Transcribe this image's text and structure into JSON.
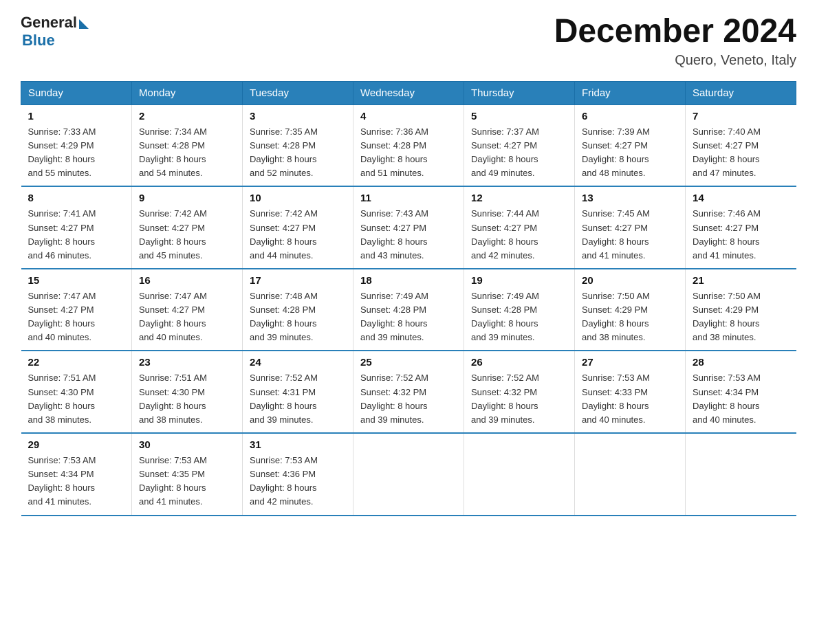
{
  "header": {
    "logo_general": "General",
    "logo_blue": "Blue",
    "title": "December 2024",
    "location": "Quero, Veneto, Italy"
  },
  "weekdays": [
    "Sunday",
    "Monday",
    "Tuesday",
    "Wednesday",
    "Thursday",
    "Friday",
    "Saturday"
  ],
  "weeks": [
    [
      {
        "day": "1",
        "sunrise": "7:33 AM",
        "sunset": "4:29 PM",
        "daylight": "8 hours and 55 minutes."
      },
      {
        "day": "2",
        "sunrise": "7:34 AM",
        "sunset": "4:28 PM",
        "daylight": "8 hours and 54 minutes."
      },
      {
        "day": "3",
        "sunrise": "7:35 AM",
        "sunset": "4:28 PM",
        "daylight": "8 hours and 52 minutes."
      },
      {
        "day": "4",
        "sunrise": "7:36 AM",
        "sunset": "4:28 PM",
        "daylight": "8 hours and 51 minutes."
      },
      {
        "day": "5",
        "sunrise": "7:37 AM",
        "sunset": "4:27 PM",
        "daylight": "8 hours and 49 minutes."
      },
      {
        "day": "6",
        "sunrise": "7:39 AM",
        "sunset": "4:27 PM",
        "daylight": "8 hours and 48 minutes."
      },
      {
        "day": "7",
        "sunrise": "7:40 AM",
        "sunset": "4:27 PM",
        "daylight": "8 hours and 47 minutes."
      }
    ],
    [
      {
        "day": "8",
        "sunrise": "7:41 AM",
        "sunset": "4:27 PM",
        "daylight": "8 hours and 46 minutes."
      },
      {
        "day": "9",
        "sunrise": "7:42 AM",
        "sunset": "4:27 PM",
        "daylight": "8 hours and 45 minutes."
      },
      {
        "day": "10",
        "sunrise": "7:42 AM",
        "sunset": "4:27 PM",
        "daylight": "8 hours and 44 minutes."
      },
      {
        "day": "11",
        "sunrise": "7:43 AM",
        "sunset": "4:27 PM",
        "daylight": "8 hours and 43 minutes."
      },
      {
        "day": "12",
        "sunrise": "7:44 AM",
        "sunset": "4:27 PM",
        "daylight": "8 hours and 42 minutes."
      },
      {
        "day": "13",
        "sunrise": "7:45 AM",
        "sunset": "4:27 PM",
        "daylight": "8 hours and 41 minutes."
      },
      {
        "day": "14",
        "sunrise": "7:46 AM",
        "sunset": "4:27 PM",
        "daylight": "8 hours and 41 minutes."
      }
    ],
    [
      {
        "day": "15",
        "sunrise": "7:47 AM",
        "sunset": "4:27 PM",
        "daylight": "8 hours and 40 minutes."
      },
      {
        "day": "16",
        "sunrise": "7:47 AM",
        "sunset": "4:27 PM",
        "daylight": "8 hours and 40 minutes."
      },
      {
        "day": "17",
        "sunrise": "7:48 AM",
        "sunset": "4:28 PM",
        "daylight": "8 hours and 39 minutes."
      },
      {
        "day": "18",
        "sunrise": "7:49 AM",
        "sunset": "4:28 PM",
        "daylight": "8 hours and 39 minutes."
      },
      {
        "day": "19",
        "sunrise": "7:49 AM",
        "sunset": "4:28 PM",
        "daylight": "8 hours and 39 minutes."
      },
      {
        "day": "20",
        "sunrise": "7:50 AM",
        "sunset": "4:29 PM",
        "daylight": "8 hours and 38 minutes."
      },
      {
        "day": "21",
        "sunrise": "7:50 AM",
        "sunset": "4:29 PM",
        "daylight": "8 hours and 38 minutes."
      }
    ],
    [
      {
        "day": "22",
        "sunrise": "7:51 AM",
        "sunset": "4:30 PM",
        "daylight": "8 hours and 38 minutes."
      },
      {
        "day": "23",
        "sunrise": "7:51 AM",
        "sunset": "4:30 PM",
        "daylight": "8 hours and 38 minutes."
      },
      {
        "day": "24",
        "sunrise": "7:52 AM",
        "sunset": "4:31 PM",
        "daylight": "8 hours and 39 minutes."
      },
      {
        "day": "25",
        "sunrise": "7:52 AM",
        "sunset": "4:32 PM",
        "daylight": "8 hours and 39 minutes."
      },
      {
        "day": "26",
        "sunrise": "7:52 AM",
        "sunset": "4:32 PM",
        "daylight": "8 hours and 39 minutes."
      },
      {
        "day": "27",
        "sunrise": "7:53 AM",
        "sunset": "4:33 PM",
        "daylight": "8 hours and 40 minutes."
      },
      {
        "day": "28",
        "sunrise": "7:53 AM",
        "sunset": "4:34 PM",
        "daylight": "8 hours and 40 minutes."
      }
    ],
    [
      {
        "day": "29",
        "sunrise": "7:53 AM",
        "sunset": "4:34 PM",
        "daylight": "8 hours and 41 minutes."
      },
      {
        "day": "30",
        "sunrise": "7:53 AM",
        "sunset": "4:35 PM",
        "daylight": "8 hours and 41 minutes."
      },
      {
        "day": "31",
        "sunrise": "7:53 AM",
        "sunset": "4:36 PM",
        "daylight": "8 hours and 42 minutes."
      },
      null,
      null,
      null,
      null
    ]
  ],
  "labels": {
    "sunrise": "Sunrise: ",
    "sunset": "Sunset: ",
    "daylight": "Daylight: "
  }
}
